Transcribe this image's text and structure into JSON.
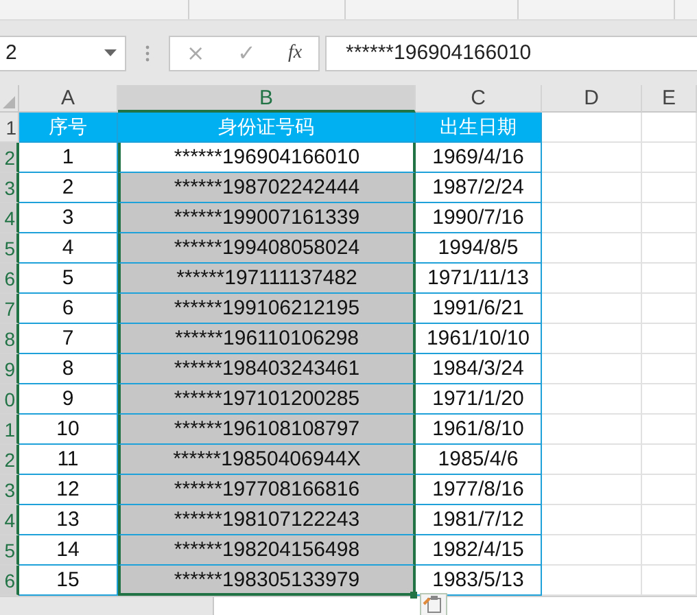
{
  "formula_bar": {
    "name_box": "2",
    "cancel": "×",
    "enter": "✓",
    "function": "fx",
    "value": "******196904166010"
  },
  "columns": [
    {
      "label": "A",
      "selected": false
    },
    {
      "label": "B",
      "selected": true
    },
    {
      "label": "C",
      "selected": false
    },
    {
      "label": "D",
      "selected": false
    },
    {
      "label": "E",
      "selected": false
    }
  ],
  "row_numbers": [
    {
      "label": "1",
      "selected": false
    },
    {
      "label": "2",
      "selected": true
    },
    {
      "label": "3",
      "selected": true
    },
    {
      "label": "4",
      "selected": true
    },
    {
      "label": "5",
      "selected": true
    },
    {
      "label": "6",
      "selected": true
    },
    {
      "label": "7",
      "selected": true
    },
    {
      "label": "8",
      "selected": true
    },
    {
      "label": "9",
      "selected": true
    },
    {
      "label": "0",
      "selected": true
    },
    {
      "label": "1",
      "selected": true
    },
    {
      "label": "2",
      "selected": true
    },
    {
      "label": "3",
      "selected": true
    },
    {
      "label": "4",
      "selected": true
    },
    {
      "label": "5",
      "selected": true
    },
    {
      "label": "6",
      "selected": true
    }
  ],
  "table": {
    "headers": [
      "序号",
      "身份证号码",
      "出生日期"
    ],
    "rows": [
      {
        "no": "1",
        "id": "******196904166010",
        "date": "1969/4/16",
        "selected": false
      },
      {
        "no": "2",
        "id": "******198702242444",
        "date": "1987/2/24",
        "selected": true
      },
      {
        "no": "3",
        "id": "******199007161339",
        "date": "1990/7/16",
        "selected": true
      },
      {
        "no": "4",
        "id": "******199408058024",
        "date": "1994/8/5",
        "selected": true
      },
      {
        "no": "5",
        "id": "******197111137482",
        "date": "1971/11/13",
        "selected": true
      },
      {
        "no": "6",
        "id": "******199106212195",
        "date": "1991/6/21",
        "selected": true
      },
      {
        "no": "7",
        "id": "******196110106298",
        "date": "1961/10/10",
        "selected": true
      },
      {
        "no": "8",
        "id": "******198403243461",
        "date": "1984/3/24",
        "selected": true
      },
      {
        "no": "9",
        "id": "******197101200285",
        "date": "1971/1/20",
        "selected": true
      },
      {
        "no": "10",
        "id": "******196108108797",
        "date": "1961/8/10",
        "selected": true
      },
      {
        "no": "11",
        "id": "******19850406944X",
        "date": "1985/4/6",
        "selected": true
      },
      {
        "no": "12",
        "id": "******197708166816",
        "date": "1977/8/16",
        "selected": true
      },
      {
        "no": "13",
        "id": "******198107122243",
        "date": "1981/7/12",
        "selected": true
      },
      {
        "no": "14",
        "id": "******198204156498",
        "date": "1982/4/15",
        "selected": true
      },
      {
        "no": "15",
        "id": "******198305133979",
        "date": "1983/5/13",
        "selected": true
      }
    ]
  }
}
